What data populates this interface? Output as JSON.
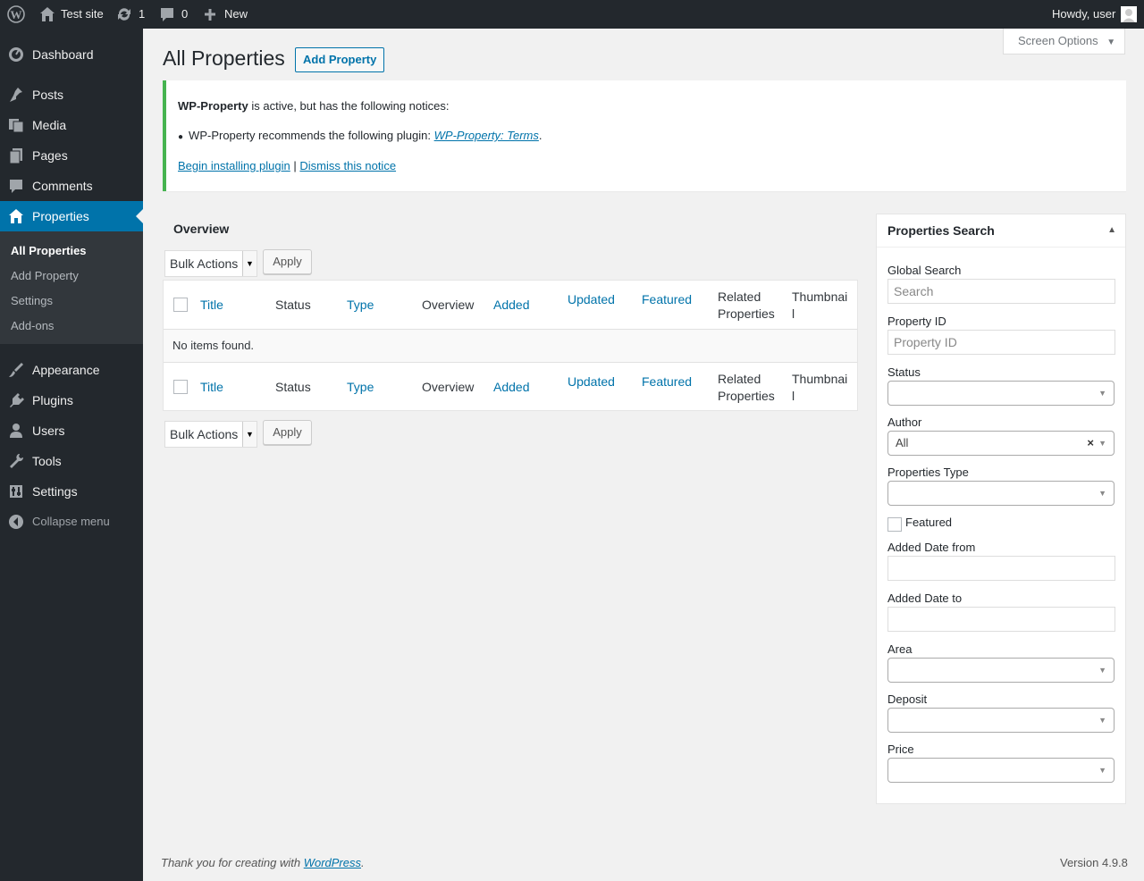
{
  "adminbar": {
    "site_name": "Test site",
    "updates_count": "1",
    "comments_count": "0",
    "new_label": "New",
    "greeting": "Howdy, user"
  },
  "sidebar": {
    "items": [
      {
        "label": "Dashboard",
        "icon": "dashboard-icon"
      },
      {
        "label": "Posts",
        "icon": "pin-icon"
      },
      {
        "label": "Media",
        "icon": "media-icon"
      },
      {
        "label": "Pages",
        "icon": "pages-icon"
      },
      {
        "label": "Comments",
        "icon": "comment-icon"
      },
      {
        "label": "Properties",
        "icon": "home-icon"
      },
      {
        "label": "Appearance",
        "icon": "brush-icon"
      },
      {
        "label": "Plugins",
        "icon": "plugin-icon"
      },
      {
        "label": "Users",
        "icon": "user-icon"
      },
      {
        "label": "Tools",
        "icon": "wrench-icon"
      },
      {
        "label": "Settings",
        "icon": "settings-icon"
      },
      {
        "label": "Collapse menu",
        "icon": "collapse-icon"
      }
    ],
    "submenu": [
      "All Properties",
      "Add Property",
      "Settings",
      "Add-ons"
    ]
  },
  "page": {
    "title": "All Properties",
    "add_button": "Add Property",
    "screen_options": "Screen Options"
  },
  "notice": {
    "plugin_name": "WP-Property",
    "line1_rest": "is active, but has the following notices:",
    "bullet_text": "WP-Property recommends the following plugin:",
    "bullet_link": "WP-Property: Terms",
    "bullet_end": ".",
    "install_link": "Begin installing plugin",
    "separator": "|",
    "dismiss_link": "Dismiss this notice"
  },
  "overview": {
    "title": "Overview",
    "bulk_actions": "Bulk Actions",
    "apply": "Apply",
    "columns": {
      "title": "Title",
      "status": "Status",
      "type": "Type",
      "overview": "Overview",
      "added": "Added",
      "updated": "Updated",
      "featured": "Featured",
      "related_1": "Related",
      "related_2": "Properties",
      "thumb_1": "Thumbnai",
      "thumb_2": "l"
    },
    "empty": "No items found."
  },
  "search": {
    "title": "Properties Search",
    "global_label": "Global Search",
    "global_placeholder": "Search",
    "id_label": "Property ID",
    "id_placeholder": "Property ID",
    "status_label": "Status",
    "author_label": "Author",
    "author_value": "All",
    "type_label": "Properties Type",
    "featured_label": "Featured",
    "date_from_label": "Added Date from",
    "date_to_label": "Added Date to",
    "area_label": "Area",
    "deposit_label": "Deposit",
    "price_label": "Price"
  },
  "footer": {
    "thanks_text": "Thank you for creating with",
    "wp_link": "WordPress",
    "period": ".",
    "version": "Version 4.9.8"
  },
  "colors": {
    "adminbar_bg": "#23282d",
    "accent": "#0073aa",
    "notice_border": "#46b450"
  }
}
